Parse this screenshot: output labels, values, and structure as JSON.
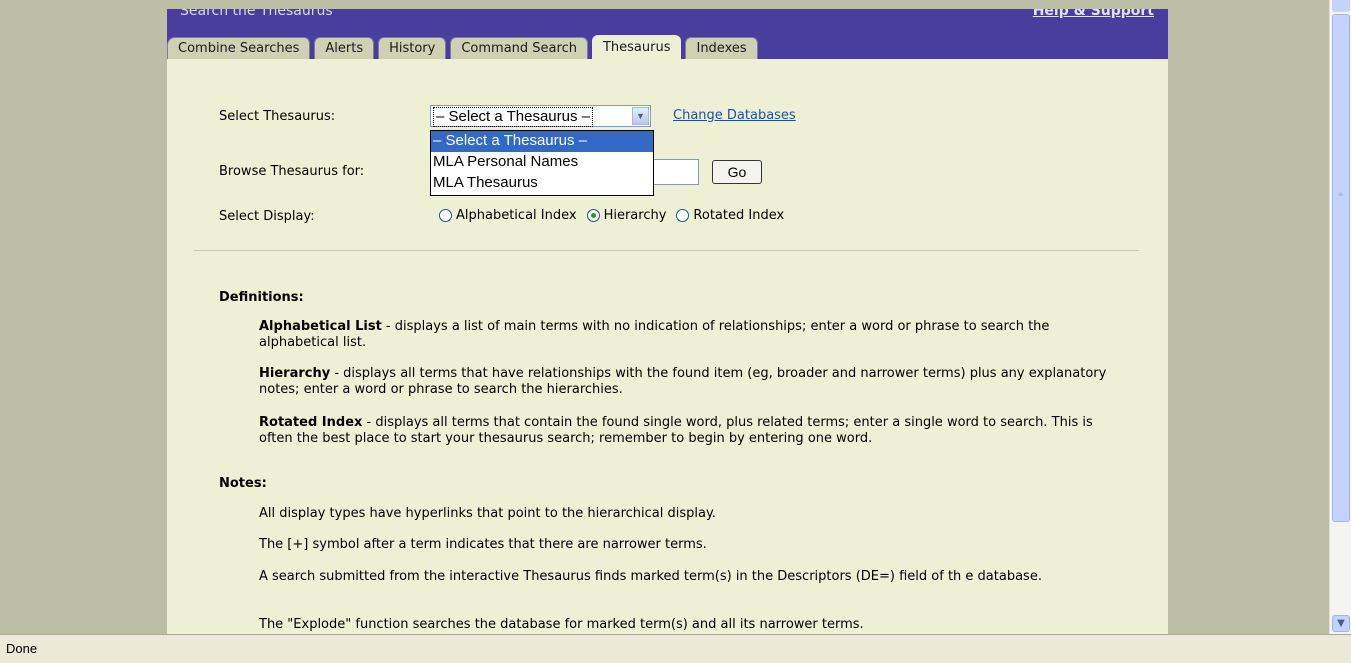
{
  "header": {
    "title": "Search the Thesaurus",
    "help_link": "Help & Support"
  },
  "tabs": [
    {
      "label": "Combine Searches"
    },
    {
      "label": "Alerts"
    },
    {
      "label": "History"
    },
    {
      "label": "Command Search"
    },
    {
      "label": "Thesaurus",
      "active": true
    },
    {
      "label": "Indexes"
    }
  ],
  "form": {
    "select_label": "Select Thesaurus:",
    "select_value": "– Select a Thesaurus –",
    "options": [
      "– Select a Thesaurus –",
      "MLA Personal Names",
      "MLA Thesaurus"
    ],
    "change_db": "Change Databases",
    "browse_label": "Browse Thesaurus for:",
    "browse_value": "",
    "go_button": "Go",
    "display_label": "Select Display:",
    "display_options": [
      {
        "label": "Alphabetical Index",
        "checked": false
      },
      {
        "label": "Hierarchy",
        "checked": true
      },
      {
        "label": "Rotated Index",
        "checked": false
      }
    ]
  },
  "definitions": {
    "heading": "Definitions:",
    "items": [
      {
        "term": "Alphabetical List",
        "text": " - displays a list of main terms with no indication of relationships; enter a word or phrase to search the alphabetical list."
      },
      {
        "term": "Hierarchy",
        "text": " - displays all terms that have relationships with the found item (eg, broader and narrower terms) plus any explanatory notes; enter a word or phrase to search the hierarchies."
      },
      {
        "term": "Rotated Index",
        "text": " - displays all terms that contain the found single word, plus related terms; enter a single word to search. This is often the best place to start your thesaurus search; remember to begin by entering one word."
      }
    ]
  },
  "notes": {
    "heading": "Notes:",
    "items": [
      "All display types have hyperlinks that point to the hierarchical display.",
      "The [+] symbol after a term indicates that there are narrower terms.",
      "A search submitted from the interactive Thesaurus finds marked term(s) in the Descriptors (DE=) field of th e database.",
      "The \"Explode\" function searches the database for marked term(s) and all its narrower terms."
    ]
  },
  "status": {
    "text": "Done"
  }
}
